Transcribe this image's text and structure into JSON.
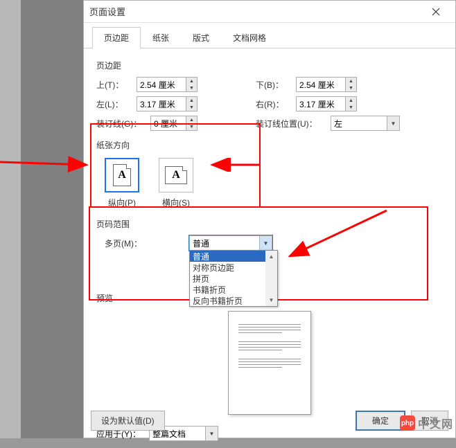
{
  "window": {
    "title": "页面设置",
    "close_icon": "close"
  },
  "tabs": {
    "items": [
      {
        "label": "页边距",
        "active": true
      },
      {
        "label": "纸张",
        "active": false
      },
      {
        "label": "版式",
        "active": false
      },
      {
        "label": "文档网格",
        "active": false
      }
    ]
  },
  "margins": {
    "group_label": "页边距",
    "top_label": "上(T)：",
    "top_value": "2.54 厘米",
    "bottom_label": "下(B)：",
    "bottom_value": "2.54 厘米",
    "left_label": "左(L)：",
    "left_value": "3.17 厘米",
    "right_label": "右(R)：",
    "right_value": "3.17 厘米",
    "gutter_label": "装订线(G)：",
    "gutter_value": "0 厘米",
    "gutter_pos_label": "装订线位置(U)：",
    "gutter_pos_value": "左"
  },
  "orientation": {
    "group_label": "纸张方向",
    "portrait_label": "纵向(P)",
    "landscape_label": "横向(S)"
  },
  "pages": {
    "group_label": "页码范围",
    "multi_label": "多页(M)：",
    "multi_value": "普通",
    "options": [
      "普通",
      "对称页边距",
      "拼页",
      "书籍折页",
      "反向书籍折页"
    ]
  },
  "preview": {
    "label": "预览"
  },
  "apply": {
    "label": "应用于(Y)：",
    "value": "整篇文档"
  },
  "footer": {
    "default_label": "设为默认值(D)",
    "ok_label": "确定",
    "cancel_label": "取消"
  },
  "watermark": {
    "icon": "php",
    "text": "中文网"
  },
  "annotations": {
    "arrows": [
      "left-to-orientation",
      "landscape-pointer",
      "dropdown-pointer"
    ],
    "boxes": [
      "orientation-box",
      "pages-preview-box"
    ]
  }
}
